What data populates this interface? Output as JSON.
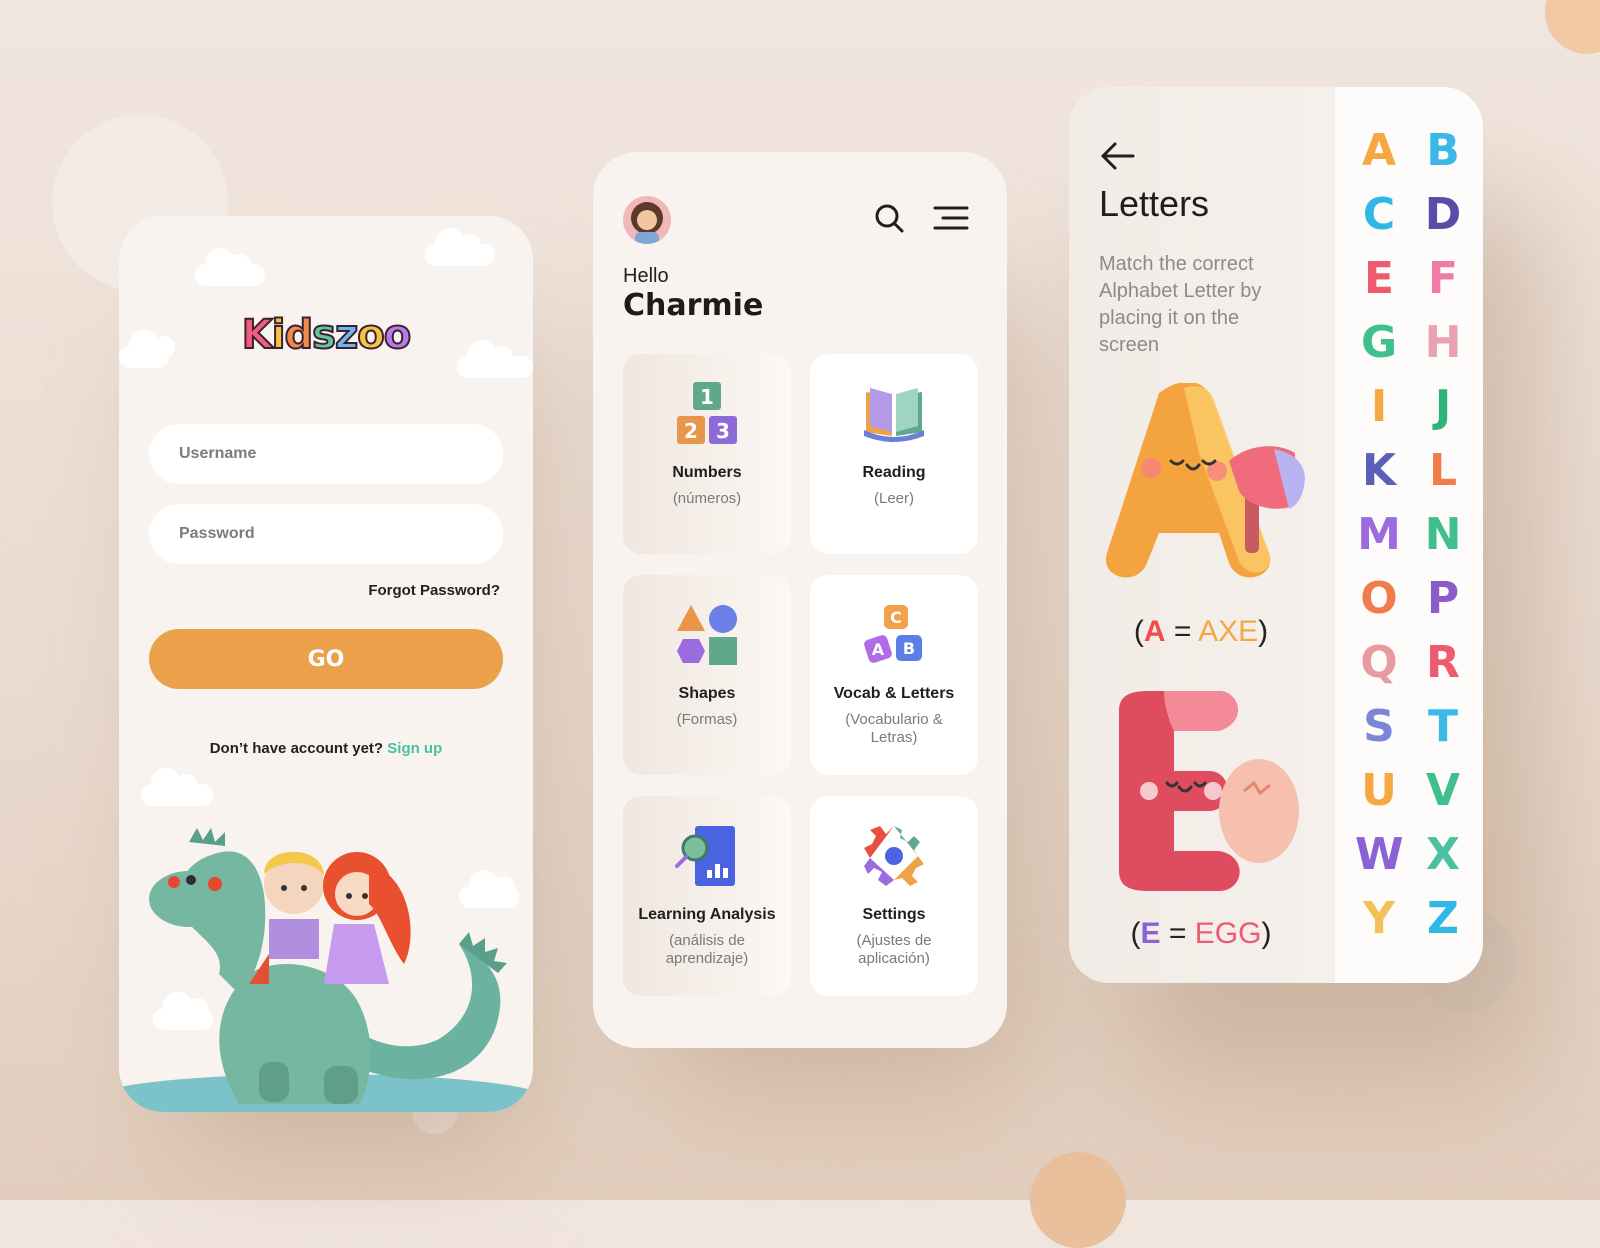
{
  "login": {
    "logo_letters": [
      {
        "ch": "K",
        "color": "#f25d7b"
      },
      {
        "ch": "i",
        "color": "#f6c343"
      },
      {
        "ch": "d",
        "color": "#f08a4b"
      },
      {
        "ch": "s",
        "color": "#5fc7a8"
      },
      {
        "ch": "z",
        "color": "#6ab8e8"
      },
      {
        "ch": "o",
        "color": "#f6c343"
      },
      {
        "ch": "o",
        "color": "#b57be6"
      }
    ],
    "username_placeholder": "Username",
    "password_placeholder": "Password",
    "forgot_label": "Forgot Password?",
    "go_label": "GO",
    "no_account_text": "Don’t have account yet?",
    "signup_label": "Sign up"
  },
  "home": {
    "greeting": "Hello",
    "user_name": "Charmie",
    "cards": [
      {
        "id": "numbers",
        "title": "Numbers",
        "subtitle": "(números)",
        "icon": "number-blocks-icon"
      },
      {
        "id": "reading",
        "title": "Reading",
        "subtitle": "(Leer)",
        "icon": "book-icon"
      },
      {
        "id": "shapes",
        "title": "Shapes",
        "subtitle": "(Formas)",
        "icon": "shapes-icon"
      },
      {
        "id": "vocab",
        "title": "Vocab & Letters",
        "subtitle": "(Vocabulario & Letras)",
        "icon": "letter-blocks-icon"
      },
      {
        "id": "analysis",
        "title": "Learning Analysis",
        "subtitle": "(análisis de aprendizaje)",
        "icon": "analysis-icon"
      },
      {
        "id": "settings",
        "title": "Settings",
        "subtitle": "(Ajustes de aplicación)",
        "icon": "gear-icon"
      }
    ],
    "number_blocks": [
      "1",
      "2",
      "3"
    ],
    "letter_blocks": [
      "C",
      "A",
      "B"
    ]
  },
  "letters": {
    "title": "Letters",
    "description": "Match the correct Alphabet Letter by placing it on the screen",
    "examples": [
      {
        "letter": "A",
        "word": "AXE",
        "letter_color": "#f04e4e",
        "word_color": "#f5a742"
      },
      {
        "letter": "E",
        "word": "EGG",
        "letter_color": "#8a62d6",
        "word_color": "#ec5b6e"
      }
    ],
    "alphabet": [
      {
        "ch": "A",
        "color": "#f5a742"
      },
      {
        "ch": "B",
        "color": "#3bb8e8"
      },
      {
        "ch": "C",
        "color": "#2fb7e6"
      },
      {
        "ch": "D",
        "color": "#5b4aa6"
      },
      {
        "ch": "E",
        "color": "#ec5b6e"
      },
      {
        "ch": "F",
        "color": "#f07aa8"
      },
      {
        "ch": "G",
        "color": "#3fbf8f"
      },
      {
        "ch": "H",
        "color": "#e8a2b0"
      },
      {
        "ch": "I",
        "color": "#f5a742"
      },
      {
        "ch": "J",
        "color": "#2fb37b"
      },
      {
        "ch": "K",
        "color": "#5b5fb8"
      },
      {
        "ch": "L",
        "color": "#f07b4b"
      },
      {
        "ch": "M",
        "color": "#9a6ce0"
      },
      {
        "ch": "N",
        "color": "#3fbf8f"
      },
      {
        "ch": "O",
        "color": "#f07b4b"
      },
      {
        "ch": "P",
        "color": "#8a5cc8"
      },
      {
        "ch": "Q",
        "color": "#e89aa0"
      },
      {
        "ch": "R",
        "color": "#ec5b6e"
      },
      {
        "ch": "S",
        "color": "#7b86d6"
      },
      {
        "ch": "T",
        "color": "#3bb8e8"
      },
      {
        "ch": "U",
        "color": "#f5a742"
      },
      {
        "ch": "V",
        "color": "#3fbf8f"
      },
      {
        "ch": "W",
        "color": "#8a62d6"
      },
      {
        "ch": "X",
        "color": "#4cc0a2"
      },
      {
        "ch": "Y",
        "color": "#f5c05a"
      },
      {
        "ch": "Z",
        "color": "#2fb7e6"
      }
    ]
  }
}
